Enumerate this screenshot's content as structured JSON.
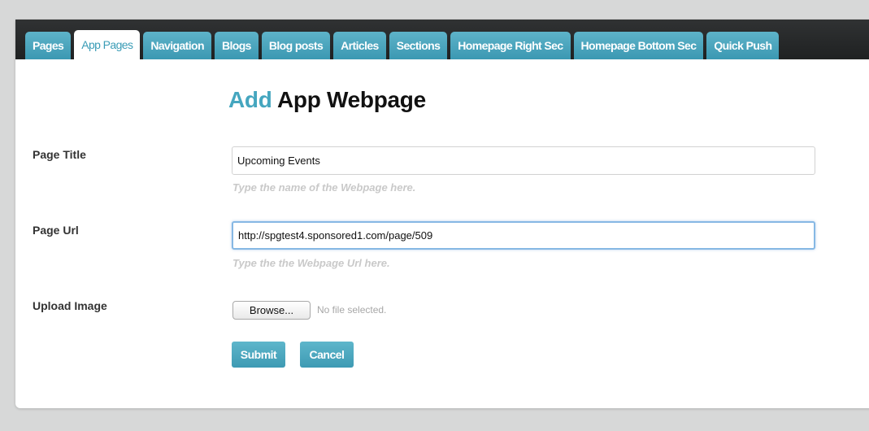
{
  "tabs": [
    {
      "label": "Pages",
      "active": false
    },
    {
      "label": "App Pages",
      "active": true
    },
    {
      "label": "Navigation",
      "active": false
    },
    {
      "label": "Blogs",
      "active": false
    },
    {
      "label": "Blog posts",
      "active": false
    },
    {
      "label": "Articles",
      "active": false
    },
    {
      "label": "Sections",
      "active": false
    },
    {
      "label": "Homepage Right Sec",
      "active": false
    },
    {
      "label": "Homepage Bottom Sec",
      "active": false
    },
    {
      "label": "Quick Push",
      "active": false
    }
  ],
  "heading": {
    "part1": "Add",
    "part2": "App Webpage"
  },
  "form": {
    "title": {
      "label": "Page Title",
      "value": "Upcoming Events",
      "hint": "Type the name of the Webpage here."
    },
    "url": {
      "label": "Page Url",
      "value": "http://spgtest4.sponsored1.com/page/509",
      "hint": "Type the the Webpage Url here."
    },
    "image": {
      "label": "Upload Image",
      "browse_label": "Browse...",
      "status": "No file selected."
    }
  },
  "buttons": {
    "submit": "Submit",
    "cancel": "Cancel"
  },
  "colors": {
    "accent": "#45a6bf",
    "tab_bg": "#3b98b2",
    "tabbar_bg": "#1f2122",
    "page_bg": "#d7d8d8",
    "focus_border": "#86b8e4"
  }
}
